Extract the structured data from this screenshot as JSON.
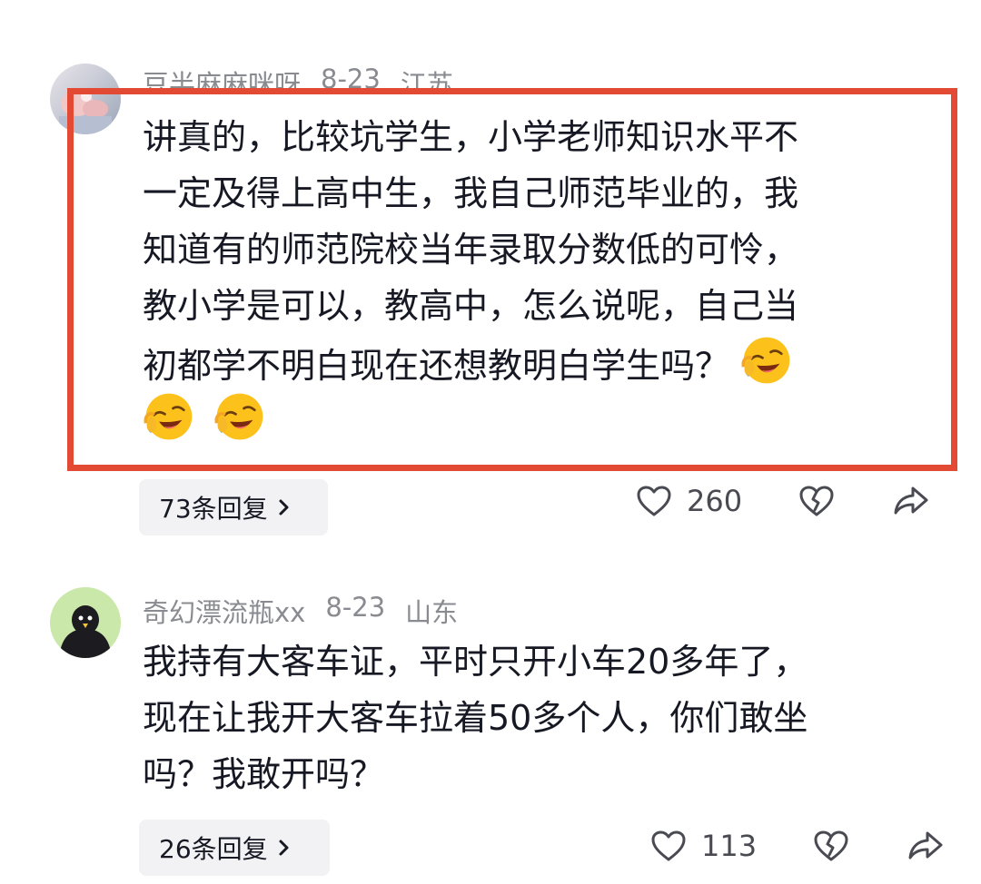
{
  "comments": [
    {
      "author": "豆半麻麻咪呀",
      "date": "8-23",
      "location": "江苏",
      "avatar_icon": "baby-photo-avatar",
      "lines": [
        "讲真的，比较坑学生，小学老师知识水平不",
        "一定及得上高中生，我自己师范毕业的，我",
        "知道有的师范院校当年录取分数低的可怜，",
        "教小学是可以，教高中，怎么说呢，自己当",
        "初都学不明白现在还想教明白学生吗？"
      ],
      "emoji_name": "laughing-crying-emoji",
      "replies_label": "73条回复",
      "like_count": "260"
    },
    {
      "author": "奇幻漂流瓶xx",
      "date": "8-23",
      "location": "山东",
      "avatar_icon": "black-bird-avatar",
      "lines": [
        "我持有大客车证，平时只开小车20多年了，",
        "现在让我开大客车拉着50多个人，你们敢坐",
        "吗？我敢开吗？"
      ],
      "replies_label": "26条回复",
      "like_count": "113"
    }
  ],
  "colors": {
    "highlight_border": "#e24a33",
    "meta_text": "#8a8b91",
    "pill_bg": "#f2f2f4",
    "avatar2_bg": "#c9e8a9"
  }
}
